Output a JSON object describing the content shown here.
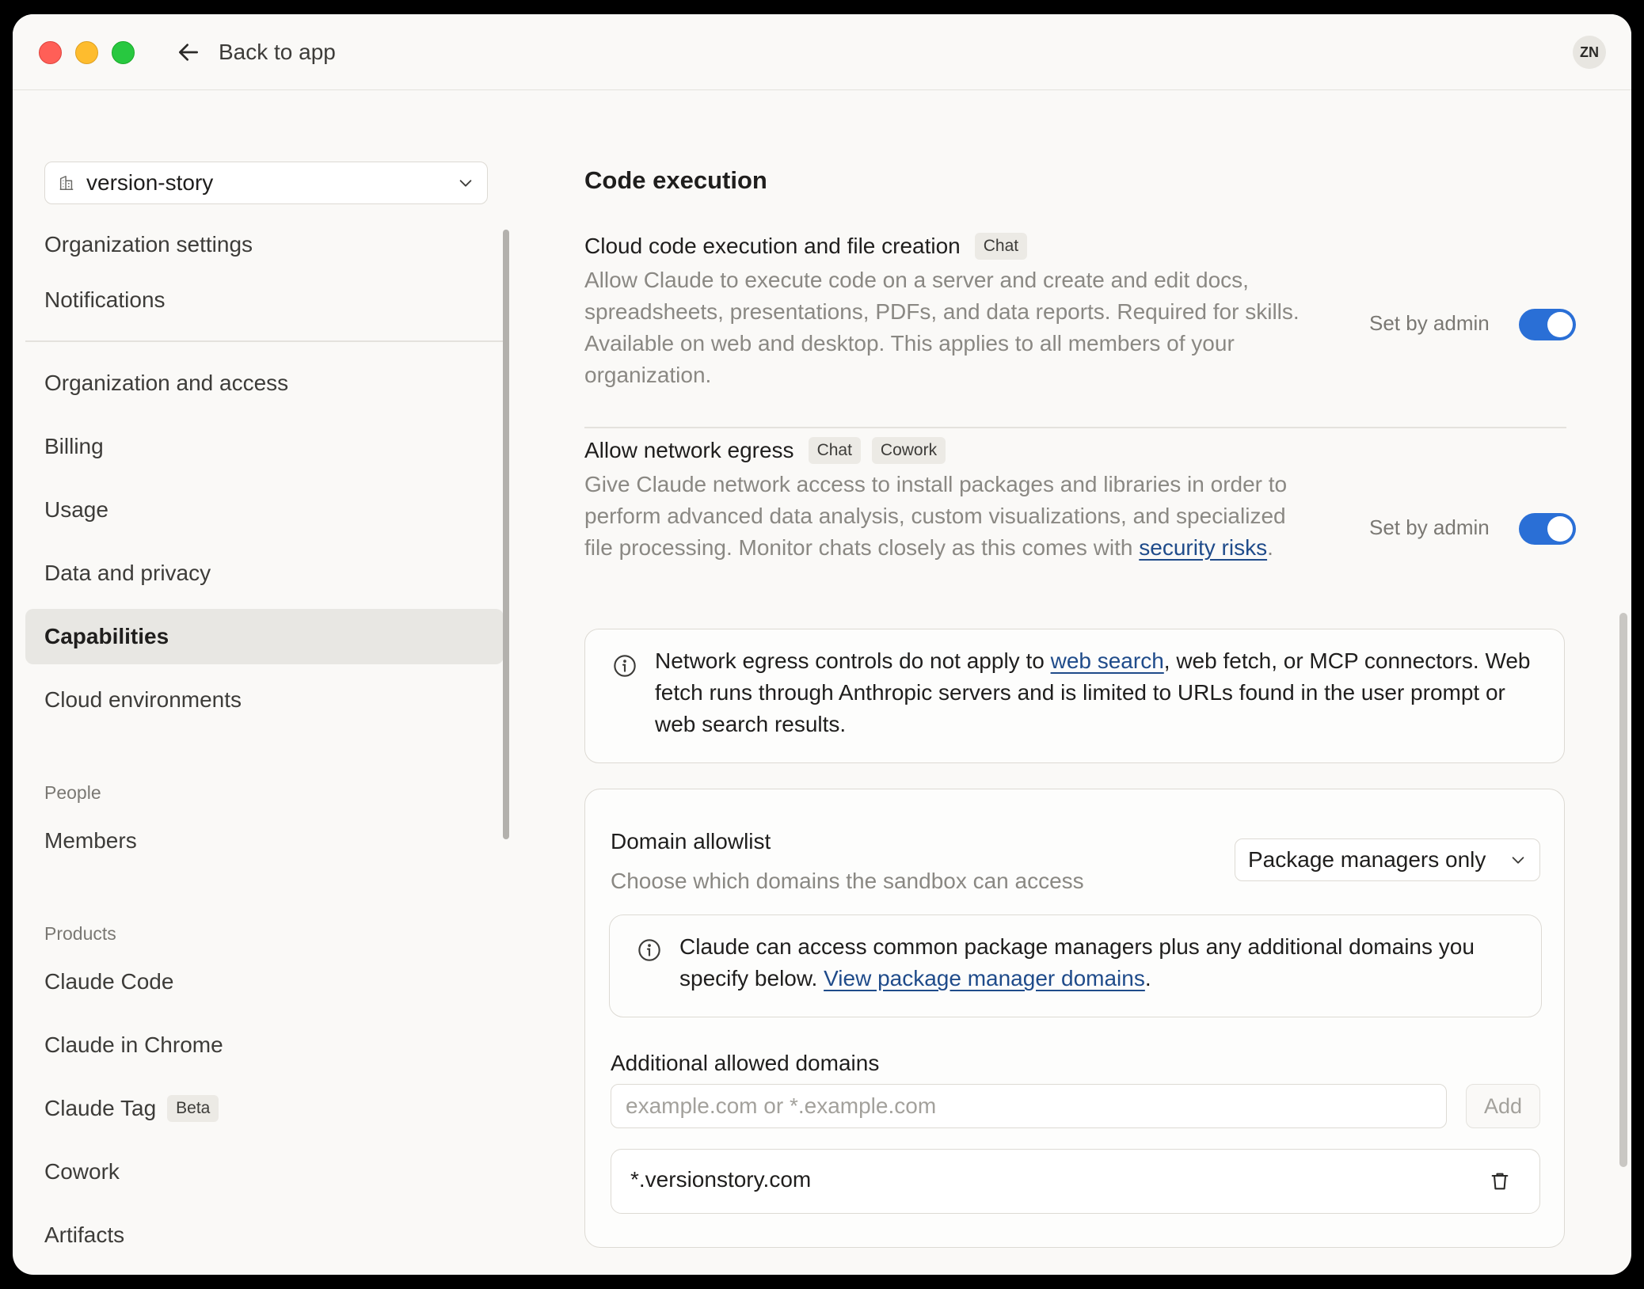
{
  "titlebar": {
    "back_label": "Back to app",
    "avatar_initials": "ZN"
  },
  "sidebar": {
    "org_name": "version-story",
    "items_top": [
      "Organization settings",
      "Notifications"
    ],
    "items_org": [
      "Organization and access",
      "Billing",
      "Usage",
      "Data and privacy",
      "Capabilities",
      "Cloud environments"
    ],
    "active_item": "Capabilities",
    "people_heading": "People",
    "people_items": [
      "Members"
    ],
    "products_heading": "Products",
    "products_items": [
      "Claude Code",
      "Claude in Chrome",
      "Claude Tag",
      "Cowork",
      "Artifacts"
    ],
    "claude_tag_badge": "Beta"
  },
  "main": {
    "section_title": "Code execution",
    "cloud_exec": {
      "title": "Cloud code execution and file creation",
      "badges": [
        "Chat"
      ],
      "description": "Allow Claude to execute code on a server and create and edit docs, spreadsheets, presentations, PDFs, and data reports. Required for skills. Available on web and desktop. This applies to all members of your organization.",
      "set_by": "Set by admin",
      "enabled": true
    },
    "network_egress": {
      "title": "Allow network egress",
      "badges": [
        "Chat",
        "Cowork"
      ],
      "description": "Give Claude network access to install packages and libraries in order to perform advanced data analysis, custom visualizations, and specialized file processing. Monitor chats closely as this comes with",
      "link": "security risks",
      "after_link": ".",
      "set_by": "Set by admin",
      "enabled": true
    },
    "egress_notice": {
      "before": "Network egress controls do not apply to ",
      "link": "web search",
      "after": ", web fetch, or MCP connectors. Web fetch runs through Anthropic servers and is limited to URLs found in the user prompt or web search results."
    },
    "allowlist": {
      "title": "Domain allowlist",
      "subtitle": "Choose which domains the sandbox can access",
      "dropdown_value": "Package managers only",
      "info_before": "Claude can access common package managers plus any additional domains you specify below. ",
      "info_link": "View package manager domains",
      "info_after": ".",
      "additional_title": "Additional allowed domains",
      "input_placeholder": "example.com or *.example.com",
      "input_value": "",
      "add_label": "Add",
      "domains": [
        "*.versionstory.com"
      ]
    }
  },
  "colors": {
    "toggle_on": "#2a6fd6",
    "link": "#1f4b8a",
    "active_nav_bg": "#e8e7e3"
  }
}
